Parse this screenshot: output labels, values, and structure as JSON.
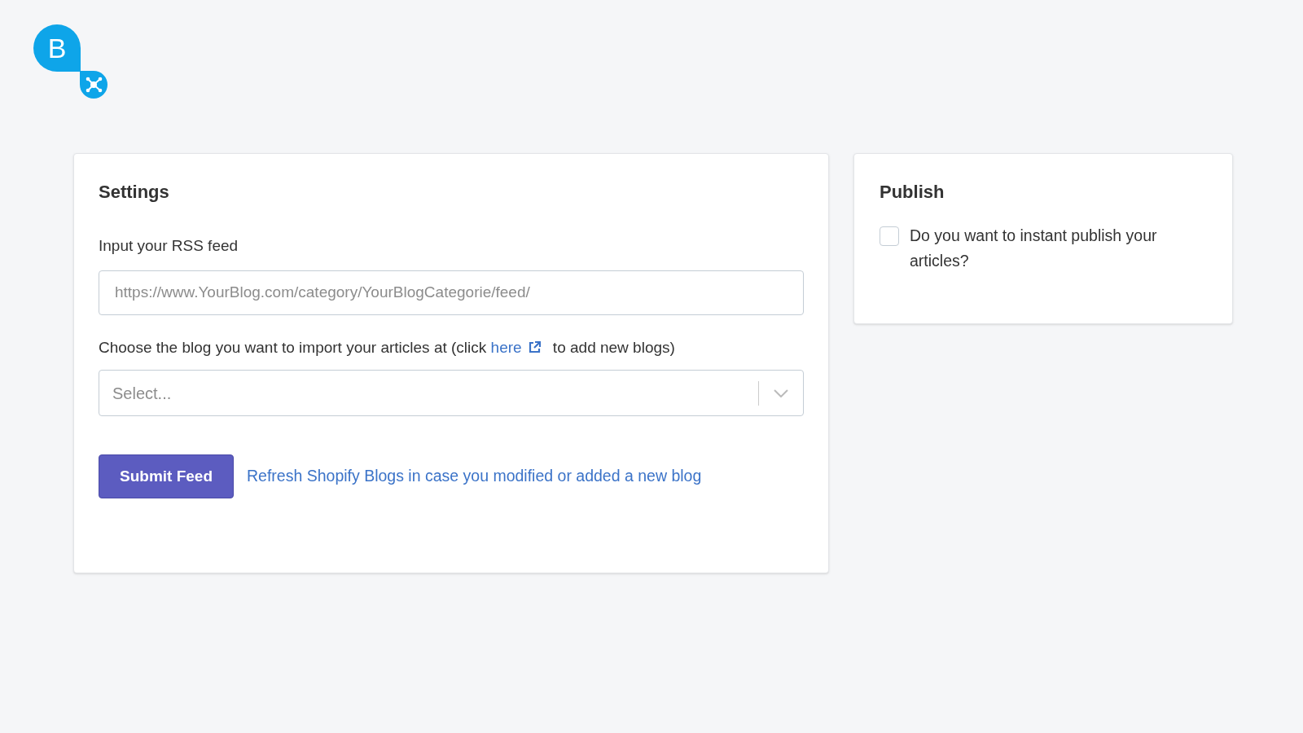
{
  "logo": {
    "letter": "B"
  },
  "settings": {
    "title": "Settings",
    "feed_label": "Input your RSS feed",
    "feed_field": {
      "placeholder": "https://www.YourBlog.com/category/YourBlogCategorie/feed/"
    },
    "blog_label": {
      "before": "Choose the blog you want to import your articles at (click",
      "link": "here",
      "after": "to add new blogs)"
    },
    "blog_select": {
      "placeholder": "Select..."
    },
    "submit_button": "Submit Feed",
    "refresh_link": "Refresh Shopify Blogs in case you modified or added a new blog"
  },
  "publish": {
    "title": "Publish",
    "checkbox": {
      "label": "Do you want to instant publish your articles?",
      "checked": false
    }
  }
}
